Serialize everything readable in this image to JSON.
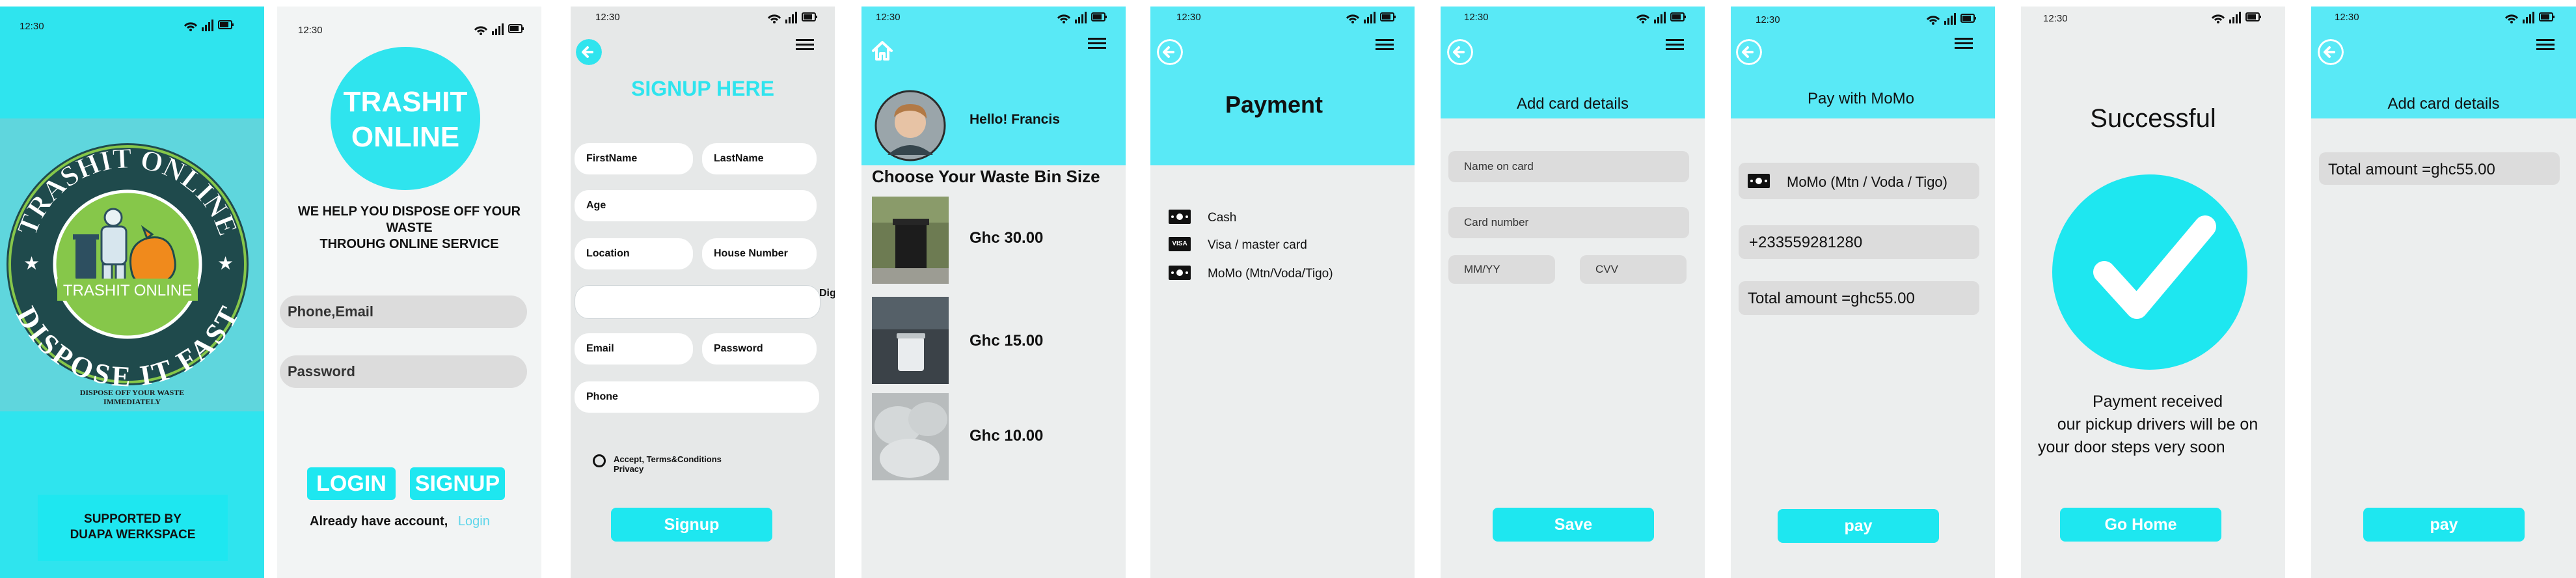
{
  "status": {
    "time": "12:30"
  },
  "colors": {
    "cyan": "#1ee7f0",
    "header_cyan": "#59e9f6",
    "grey": "#eceeee",
    "field": "#dcdcdc",
    "logo_green": "#86c74a",
    "logo_dark": "#1f4a4c"
  },
  "splash": {
    "logo_ring_top": "TRASHIT ONLINE",
    "logo_ring_bottom": "DISPOSE IT FAST",
    "logo_center": "TRASHIT ONLINE",
    "tagline_1": "DISPOSE OFF YOUR WASTE",
    "tagline_2": "IMMEDIATELY",
    "supported_1": "SUPPORTED BY",
    "supported_2": "DUAPA WERKSPACE"
  },
  "login": {
    "logo_line1": "TRASHIT",
    "logo_line2": "ONLINE",
    "tag_line1": "WE HELP YOU DISPOSE  OFF YOUR",
    "tag_line2": "WASTE",
    "tag_line3": "THROUHG ONLINE SERVICE",
    "phone_placeholder": "Phone,Email",
    "password_placeholder": "Password",
    "login_label": "LOGIN",
    "signup_label": "SIGNUP",
    "already_text": "Already have account,",
    "login_link": "Login"
  },
  "signup": {
    "title": "SIGNUP HERE",
    "first_name": "FirstName",
    "last_name": "LastName",
    "age": "Age",
    "location": "Location",
    "house_number": "House Number",
    "digital": "Digital a",
    "email": "Email",
    "password": "Password",
    "phone": "Phone",
    "terms_1": "Accept, Terms&Conditions",
    "terms_2": "Privacy",
    "signup_button": "Signup"
  },
  "bins": {
    "greeting": "Hello!  Francis",
    "heading": "Choose Your Waste Bin Size",
    "items": [
      {
        "price": "Ghc 30.00"
      },
      {
        "price": "Ghc 15.00"
      },
      {
        "price": "Ghc 10.00"
      }
    ]
  },
  "payment": {
    "title": "Payment",
    "options": [
      {
        "label": "Cash",
        "icon": "cash-icon"
      },
      {
        "label": "Visa / master card",
        "icon": "visa-icon",
        "badge": "VISA"
      },
      {
        "label": "MoMo (Mtn/Voda/Tigo)",
        "icon": "cash-icon"
      }
    ]
  },
  "card": {
    "title": "Add card details",
    "name_placeholder": "Name on card",
    "number_placeholder": "Card number",
    "expiry_placeholder": "MM/YY",
    "cvv_placeholder": "CVV",
    "save_label": "Save"
  },
  "momo": {
    "title": "Pay with MoMo",
    "network": "MoMo (Mtn / Voda / Tigo)",
    "phone": "+233559281280",
    "total": "Total amount =ghc55.00",
    "pay_label": "pay"
  },
  "success": {
    "title": "Successful",
    "msg_1": "Payment received",
    "msg_2": "our pickup drivers will be on",
    "msg_3": "your door steps very soon",
    "home_label": "Go Home"
  },
  "card_total": {
    "title": "Add card details",
    "total": "Total amount =ghc55.00",
    "pay_label": "pay"
  }
}
